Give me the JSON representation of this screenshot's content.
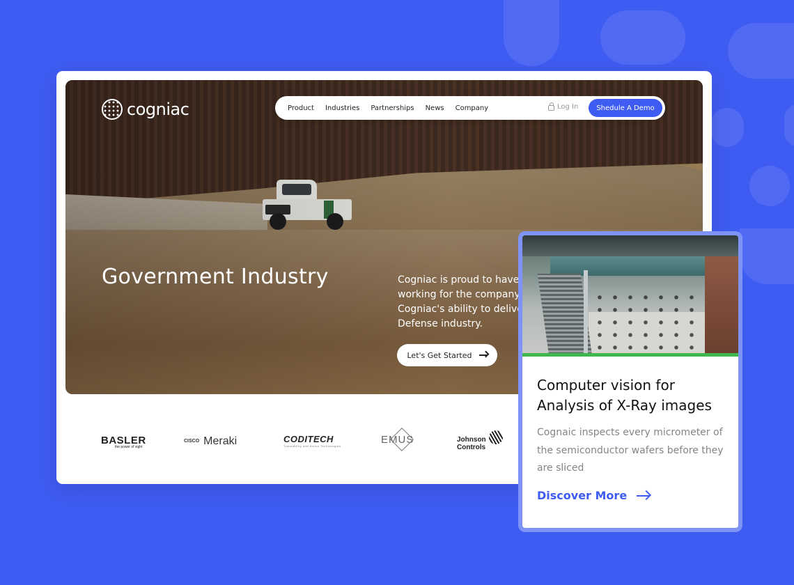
{
  "brand": {
    "name": "cogniac"
  },
  "nav": {
    "items": [
      "Product",
      "Industries",
      "Partnerships",
      "News",
      "Company"
    ],
    "login_label": "Log In",
    "demo_label": "Shedule A Demo"
  },
  "hero": {
    "title": "Government Industry",
    "description_lines": [
      "Cogniac is proud to have f",
      "working for the company.",
      "Cogniac's ability to deliver",
      "Defense industry."
    ],
    "cta_label": "Let's Get Started"
  },
  "partners": {
    "basler": "BASLER",
    "basler_tagline": "the power of sight",
    "cisco": "CISCO",
    "meraki": "Meraki",
    "coditech": "CODITECH",
    "coditech_tagline": "Traceability and Action Technologies",
    "emus": "EMUS",
    "johnson_line1": "Johnson",
    "johnson_line2": "Controls"
  },
  "card": {
    "title_line1": "Computer vision for",
    "title_line2": "Analysis of X-Ray images",
    "description": "Cognaic inspects every micrometer of the semiconductor wafers before they are sliced",
    "link_label": "Discover More"
  },
  "colors": {
    "accent": "#3f5cf2",
    "card_bar": "#3fb64e"
  },
  "icons": [
    "cogniac-logo-icon",
    "lock-icon",
    "arrow-right-icon"
  ]
}
